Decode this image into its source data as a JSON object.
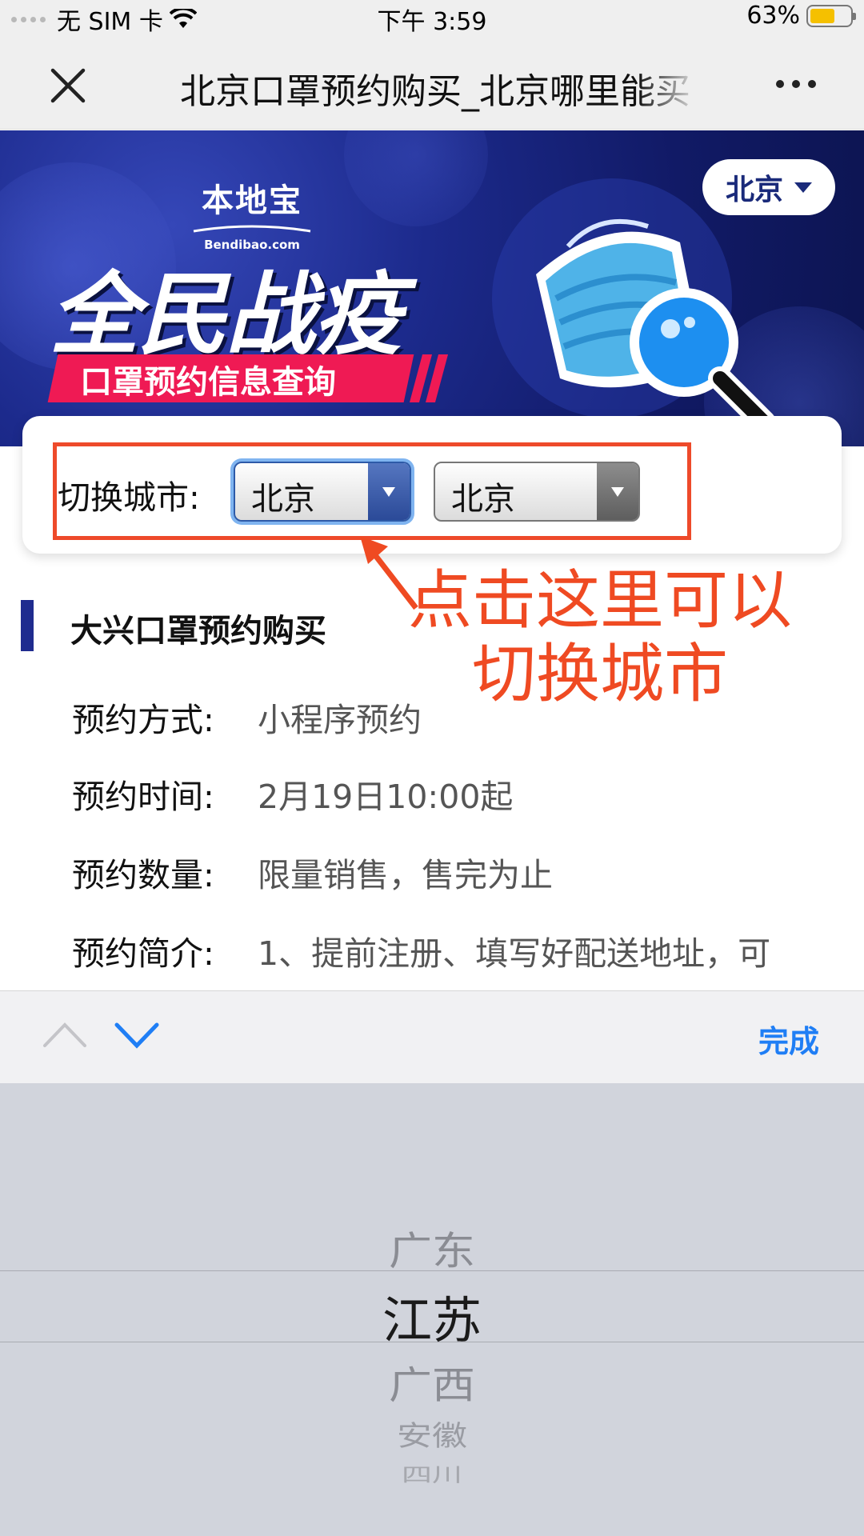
{
  "status_bar": {
    "carrier": "无 SIM 卡",
    "time": "下午 3:59",
    "battery": "63%",
    "battery_level": 0.63
  },
  "nav": {
    "title": "北京口罩预约购买_北京哪里能买"
  },
  "banner": {
    "logo_cn": "本地宝",
    "logo_en": "Bendibao.com",
    "headline": "全民战疫",
    "subtitle": "口罩预约信息查询",
    "city_button": "北京"
  },
  "city_switcher": {
    "label": "切换城市:",
    "province_value": "北京",
    "city_value": "北京"
  },
  "annotation": {
    "line1": "点击这里可以",
    "line2": "切换城市"
  },
  "section": {
    "title": "大兴口罩预约购买",
    "rows": [
      {
        "key": "预约方式:",
        "value": "小程序预约"
      },
      {
        "key": "预约时间:",
        "value": "2月19日10:00起"
      },
      {
        "key": "预约数量:",
        "value": "限量销售，售完为止"
      },
      {
        "key": "预约简介:",
        "value": "1、提前注册、填写好配送地址，可"
      }
    ]
  },
  "keyboard_toolbar": {
    "done_label": "完成"
  },
  "picker": {
    "options": [
      "广东",
      "江苏",
      "广西",
      "安徽",
      "四川"
    ],
    "selected": "江苏"
  },
  "colors": {
    "accent_blue": "#1f7ef5",
    "annotation_red": "#ef4a22",
    "banner_navy": "#1c2a8c",
    "banner_pink": "#ef1a54"
  }
}
